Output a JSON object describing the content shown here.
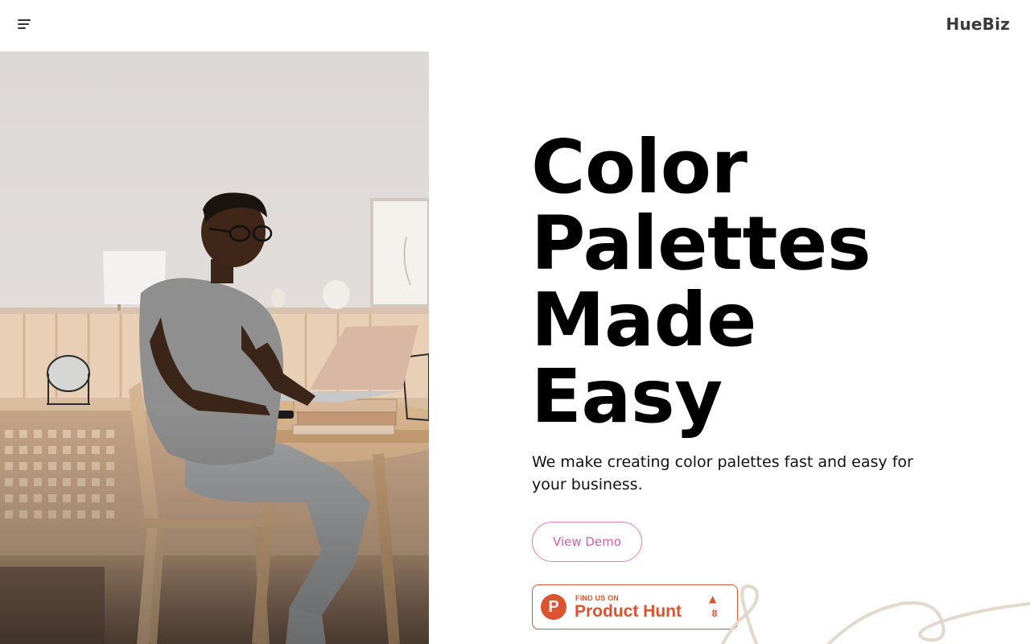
{
  "header": {
    "brand": "HueBiz"
  },
  "hero": {
    "title_lines": [
      "Color",
      "Palettes",
      "Made",
      "Easy"
    ],
    "subtitle": "We make creating color palettes fast and easy for your business.",
    "demo_button_label": "View Demo",
    "photo_icon": "person-working-on-laptop-photo"
  },
  "product_hunt": {
    "small_label": "FIND US ON",
    "name": "Product Hunt",
    "logo_letter": "P",
    "upvote_count": "8",
    "color": "#da552f"
  },
  "colors": {
    "accent_pink": "#d35fae",
    "product_hunt": "#da552f"
  }
}
